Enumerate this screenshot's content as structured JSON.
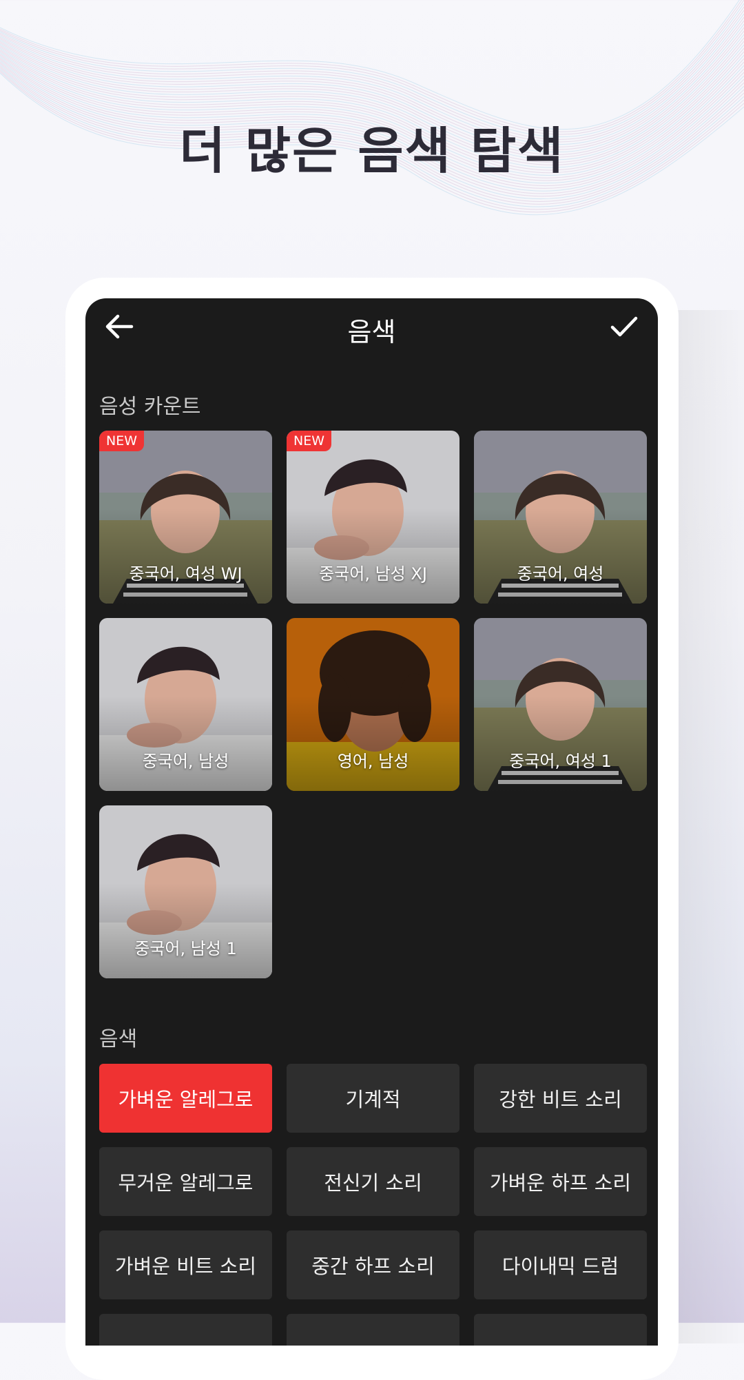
{
  "headline": "더 많은 음색 탐색",
  "app": {
    "title": "음색",
    "back_icon": "arrow-left-icon",
    "confirm_icon": "checkmark-icon"
  },
  "voice_section": {
    "label": "음성 카운트",
    "cards": [
      {
        "label": "중국어, 여성 WJ",
        "badge": "NEW",
        "portrait": "female"
      },
      {
        "label": "중국어, 남성 XJ",
        "badge": "NEW",
        "portrait": "male"
      },
      {
        "label": "중국어, 여성",
        "badge": "",
        "portrait": "female"
      },
      {
        "label": "중국어, 남성",
        "badge": "",
        "portrait": "male"
      },
      {
        "label": "영어, 남성",
        "badge": "",
        "portrait": "curly"
      },
      {
        "label": "중국어, 여성 1",
        "badge": "",
        "portrait": "female"
      },
      {
        "label": "중국어, 남성 1",
        "badge": "",
        "portrait": "male"
      }
    ]
  },
  "timbre_section": {
    "label": "음색",
    "selected_index": 0,
    "chips": [
      "가벼운 알레그로",
      "기계적",
      "강한 비트 소리",
      "무거운 알레그로",
      "전신기 소리",
      "가벼운 하프 소리",
      "가벼운 비트 소리",
      "중간 하프 소리",
      "다이내믹 드럼"
    ]
  },
  "colors": {
    "accent": "#ef3232",
    "screen_bg": "#1b1b1b",
    "chip_bg": "#2e2e2e"
  }
}
